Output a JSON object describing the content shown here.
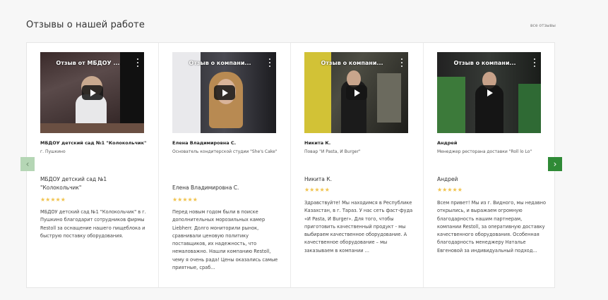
{
  "section": {
    "title": "Отзывы о нашей работе",
    "all_link": "все отзывы"
  },
  "nav": {
    "prev_icon": "chevron-left-icon",
    "next_icon": "chevron-right-icon",
    "prev_glyph": "‹",
    "next_glyph": "›"
  },
  "colors": {
    "accent": "#2f8a36",
    "accent_disabled": "#b5d6b5",
    "star": "#f0c24b"
  },
  "reviews": [
    {
      "video_title": "Отзыв от МБДОУ ...",
      "name": "МБДОУ детский сад №1 \"Колокольчик\"",
      "role": "г. Пушкино",
      "reviewer": "МБДОУ детский сад №1 \"Колокольчик\"",
      "stars": "★★★★★",
      "text": "МБДОУ детский сад №1 \"Колокольчик\" в г. Пушкино благодарит сотрудников фирмы Restoll за оснащение нашего пищеблока и быструю поставку оборудования."
    },
    {
      "video_title": "Отзыв о компани...",
      "name": "Елена Владимировна С.",
      "role": "Основатель кондитерской студии \"She's Cake\"",
      "reviewer": "Елена Владимировна С.",
      "stars": "★★★★★",
      "text": "Перед новым годом были в поиске дополнительных морозильных камер Liebherr. Долго мониторили рынок, сравнивали ценовую политику поставщиков, их надежность, что немаловажно. Нашли компанию Restoll, чему я очень рада! Цены оказались самые приятные, сраб..."
    },
    {
      "video_title": "Отзыв о компани...",
      "name": "Никита К.",
      "role": "Повар \"И Pasta, И Burger\"",
      "reviewer": "Никита К.",
      "stars": "★★★★★",
      "text": "Здравствуйте! Мы находимся в Республике Казахстан, в г. Тараз. У нас сеть фаст-фуда «И Pasta, И Burger». Для того, чтобы приготовить качественный продукт - мы выбираем качественное оборудование. А качественное оборудование – мы заказываем в компании ..."
    },
    {
      "video_title": "Отзыв о компани...",
      "name": "Андрей",
      "role": "Менеджер ресторана доставки \"Roll lo Lo\"",
      "reviewer": "Андрей",
      "stars": "★★★★★",
      "text": "Всем привет! Мы из г. Видного, мы недавно открылись, и выражаем огромную благодарность нашим партнерам, компании Restoll, за оперативную доставку качественного оборудования. Особенная благодарность менеджеру Наталье Евгеновой за индивидуальный подход..."
    }
  ]
}
